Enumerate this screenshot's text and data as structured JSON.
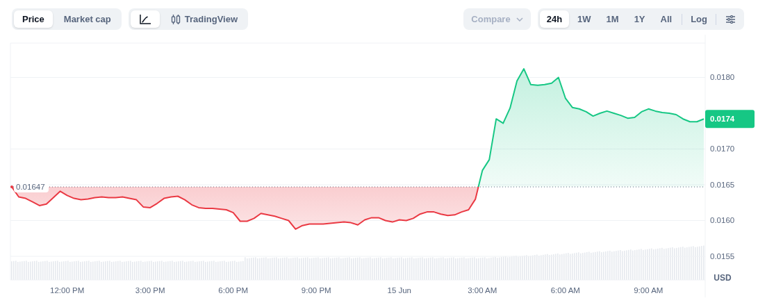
{
  "toolbar": {
    "metric_tabs": [
      {
        "label": "Price",
        "selected": true
      },
      {
        "label": "Market cap",
        "selected": false
      }
    ],
    "view_tabs": [
      {
        "kind": "line",
        "selected": true
      },
      {
        "kind": "tradingview",
        "label": "TradingView",
        "selected": false
      }
    ],
    "compare": {
      "label": "Compare",
      "disabled": true
    },
    "ranges": [
      {
        "label": "24h",
        "selected": true
      },
      {
        "label": "1W",
        "selected": false
      },
      {
        "label": "1M",
        "selected": false
      },
      {
        "label": "1Y",
        "selected": false
      },
      {
        "label": "All",
        "selected": false
      }
    ],
    "log": {
      "label": "Log",
      "selected": false
    }
  },
  "chart": {
    "chart_data": {
      "type": "area",
      "ylabel": "USD",
      "categories": [
        null,
        null,
        null,
        null,
        null,
        null,
        null,
        null,
        "12:00 PM",
        null,
        null,
        null,
        null,
        null,
        null,
        null,
        null,
        null,
        null,
        null,
        "3:00 PM",
        null,
        null,
        null,
        null,
        null,
        null,
        null,
        null,
        null,
        null,
        null,
        "6:00 PM",
        null,
        null,
        null,
        null,
        null,
        null,
        null,
        null,
        null,
        null,
        null,
        "9:00 PM",
        null,
        null,
        null,
        null,
        null,
        null,
        null,
        null,
        null,
        null,
        null,
        "15 Jun",
        null,
        null,
        null,
        null,
        null,
        null,
        null,
        null,
        null,
        null,
        null,
        "3:00 AM",
        null,
        null,
        null,
        null,
        null,
        null,
        null,
        null,
        null,
        null,
        null,
        "6:00 AM",
        null,
        null,
        null,
        null,
        null,
        null,
        null,
        null,
        null,
        null,
        null,
        "9:00 AM",
        null,
        null,
        null,
        null,
        null,
        null,
        null,
        null
      ],
      "series": [
        {
          "values": [
            0.01647,
            0.01633,
            0.01631,
            0.01626,
            0.01621,
            0.01623,
            0.01632,
            0.01641,
            0.01635,
            0.01631,
            0.01629,
            0.0163,
            0.01632,
            0.01633,
            0.01632,
            0.01632,
            0.01633,
            0.01631,
            0.01629,
            0.01619,
            0.01618,
            0.01624,
            0.01631,
            0.01633,
            0.01634,
            0.01629,
            0.01622,
            0.01618,
            0.01617,
            0.01617,
            0.01616,
            0.01615,
            0.01611,
            0.01599,
            0.01599,
            0.01603,
            0.0161,
            0.01608,
            0.01606,
            0.01603,
            0.016,
            0.01588,
            0.01593,
            0.01595,
            0.01595,
            0.01595,
            0.01596,
            0.01597,
            0.01598,
            0.01597,
            0.01594,
            0.01601,
            0.01604,
            0.01604,
            0.016,
            0.01598,
            0.01601,
            0.016,
            0.01603,
            0.01609,
            0.01612,
            0.01612,
            0.01609,
            0.01607,
            0.01608,
            0.01612,
            0.01615,
            0.0163,
            0.0167,
            0.01685,
            0.01742,
            0.01736,
            0.01757,
            0.01795,
            0.01812,
            0.0179,
            0.01789,
            0.0179,
            0.01792,
            0.018,
            0.01771,
            0.01758,
            0.01756,
            0.01752,
            0.01746,
            0.0175,
            0.01753,
            0.0175,
            0.01747,
            0.01743,
            0.01744,
            0.01752,
            0.01756,
            0.01753,
            0.01751,
            0.0175,
            0.01748,
            0.01742,
            0.01738,
            0.01738,
            0.01742
          ]
        }
      ],
      "ylim": [
        0.01517,
        0.01848
      ],
      "grid": true,
      "yticks": [
        {
          "value": 0.0155,
          "label": "0.0155"
        },
        {
          "value": 0.016,
          "label": "0.0160"
        },
        {
          "value": 0.0165,
          "label": "0.0165"
        },
        {
          "value": 0.017,
          "label": "0.0170"
        },
        {
          "value": 0.018,
          "label": "0.0180"
        }
      ],
      "ref_lines": [
        {
          "axis": "y",
          "value": 0.01647,
          "label": "0.01647"
        }
      ],
      "annotations": [
        "0.0174"
      ]
    }
  }
}
